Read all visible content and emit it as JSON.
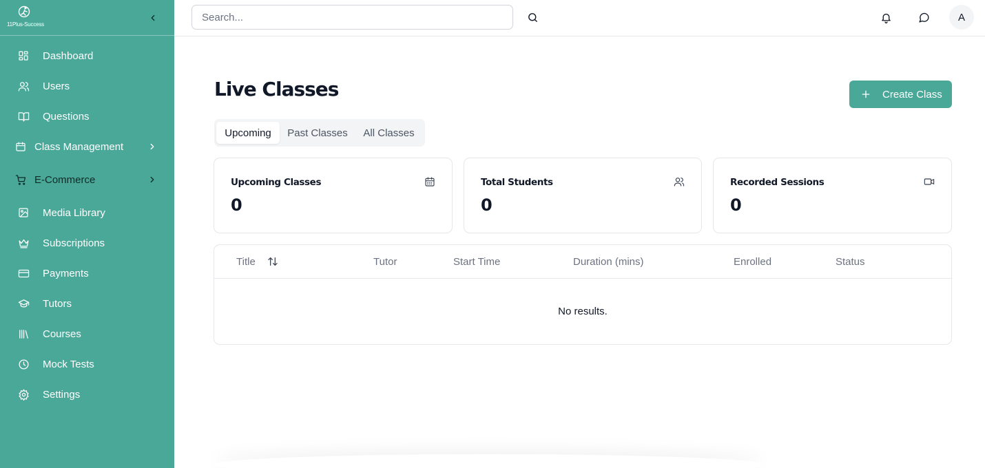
{
  "brand": {
    "logo_text": "11Plus-Success"
  },
  "sidebar": {
    "items": [
      {
        "label": "Dashboard",
        "icon": "dashboard-icon"
      },
      {
        "label": "Users",
        "icon": "users-icon"
      },
      {
        "label": "Questions",
        "icon": "book-open-icon"
      },
      {
        "label": "Class Management",
        "icon": "calendar-icon",
        "expandable": true
      },
      {
        "label": "E-Commerce",
        "icon": "cart-icon",
        "expandable": true
      },
      {
        "label": "Media Library",
        "icon": "image-icon"
      },
      {
        "label": "Subscriptions",
        "icon": "crown-icon"
      },
      {
        "label": "Payments",
        "icon": "credit-card-icon"
      },
      {
        "label": "Tutors",
        "icon": "graduation-cap-icon"
      },
      {
        "label": "Courses",
        "icon": "library-icon"
      },
      {
        "label": "Mock Tests",
        "icon": "clock-icon"
      },
      {
        "label": "Settings",
        "icon": "gear-icon"
      }
    ]
  },
  "header": {
    "search_placeholder": "Search...",
    "avatar_initial": "A"
  },
  "main": {
    "title": "Live Classes",
    "create_label": "Create Class",
    "tabs": [
      {
        "label": "Upcoming",
        "active": true
      },
      {
        "label": "Past Classes",
        "active": false
      },
      {
        "label": "All Classes",
        "active": false
      }
    ],
    "stats": [
      {
        "title": "Upcoming Classes",
        "value": "0",
        "icon": "calendar-icon"
      },
      {
        "title": "Total Students",
        "value": "0",
        "icon": "users-icon"
      },
      {
        "title": "Recorded Sessions",
        "value": "0",
        "icon": "video-icon"
      }
    ],
    "table": {
      "columns": [
        "Title",
        "Tutor",
        "Start Time",
        "Duration (mins)",
        "Enrolled",
        "Status"
      ],
      "empty_text": "No results."
    }
  },
  "colors": {
    "accent": "#4aa899",
    "border": "#e5e7eb"
  }
}
